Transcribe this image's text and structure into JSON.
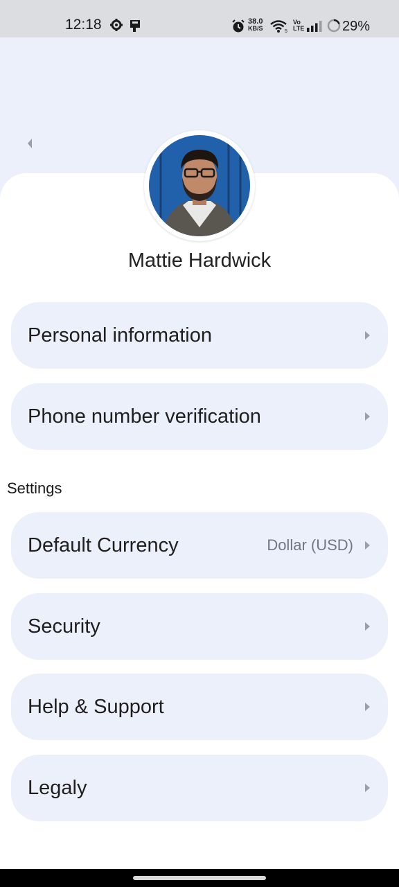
{
  "status_bar": {
    "time": "12:18",
    "speed_value": "38.0",
    "speed_unit": "KB/S",
    "volte": "Vo LTE",
    "battery_percent": "29%"
  },
  "profile": {
    "name": "Mattie Hardwick"
  },
  "menu": [
    {
      "label": "Personal information",
      "value": ""
    },
    {
      "label": "Phone number verification",
      "value": ""
    }
  ],
  "settings": {
    "title": "Settings",
    "items": [
      {
        "label": "Default Currency",
        "value": "Dollar (USD)"
      },
      {
        "label": "Security",
        "value": ""
      },
      {
        "label": "Help & Support",
        "value": ""
      },
      {
        "label": "Legaly",
        "value": ""
      }
    ]
  },
  "colors": {
    "header_background": "#ebf0fa",
    "item_background": "#ebf0fa",
    "value_text": "#707684"
  }
}
